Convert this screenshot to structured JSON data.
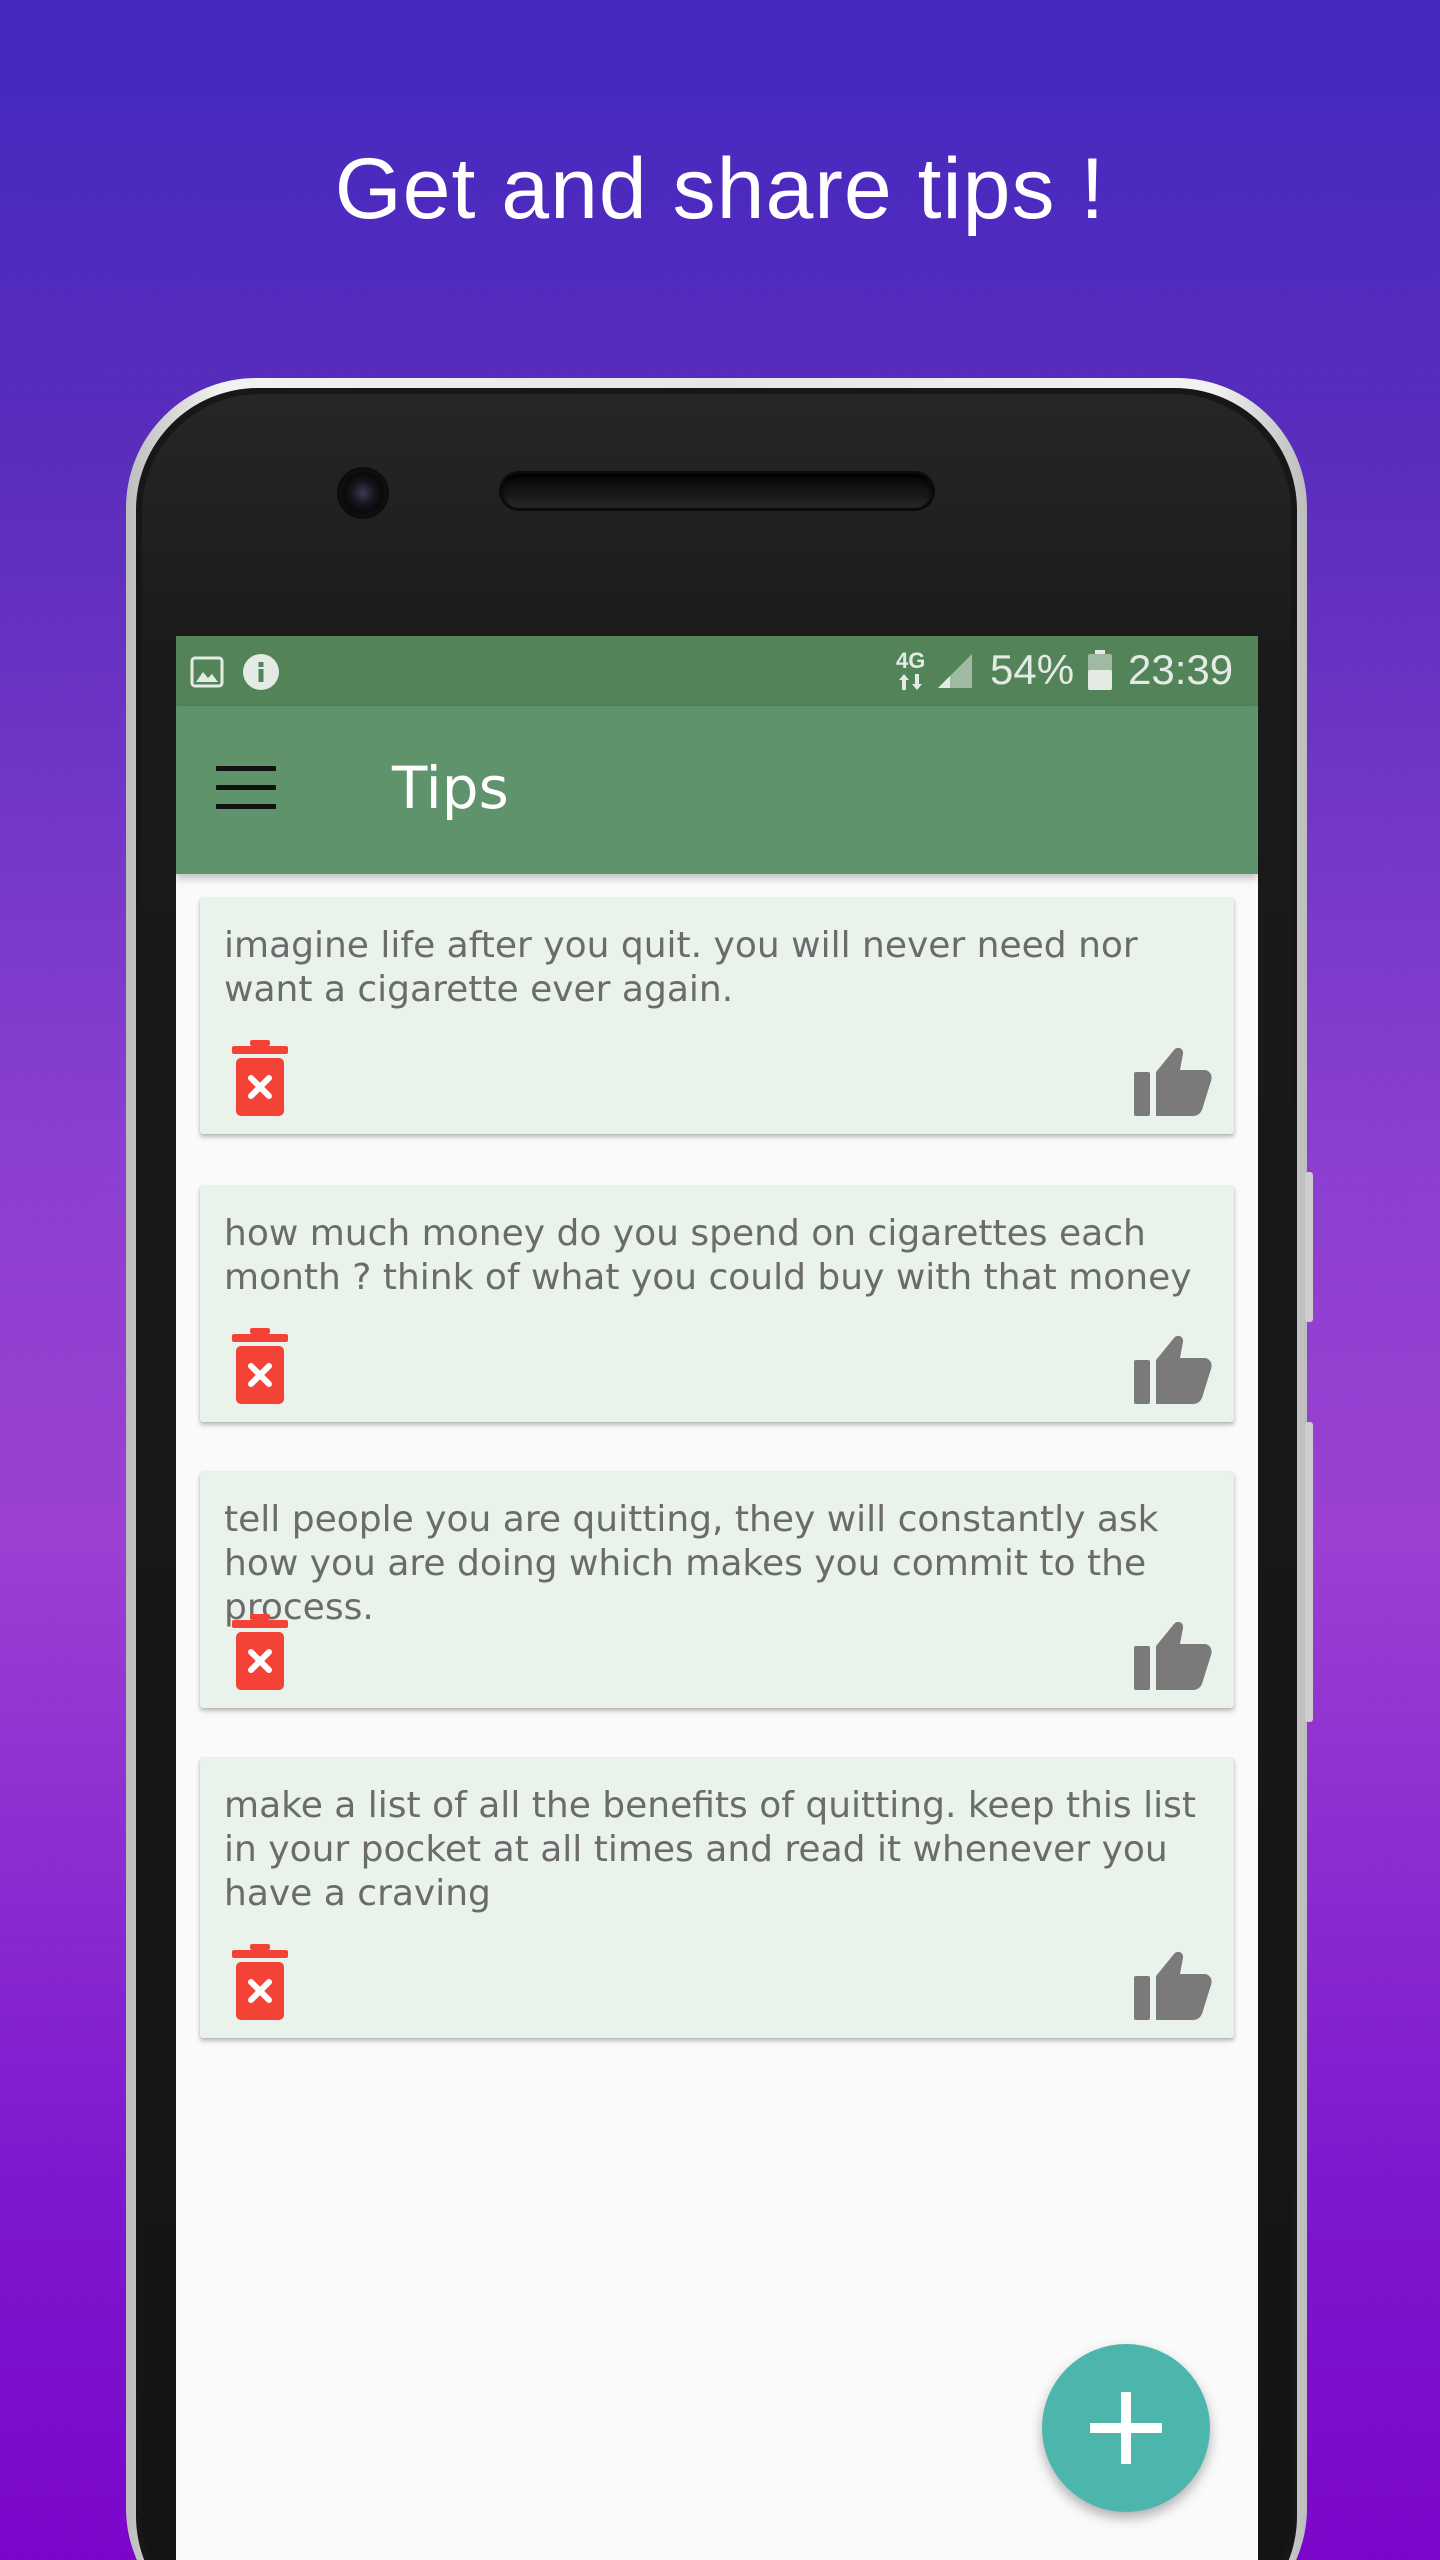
{
  "promo": {
    "headline": "Get and share tips !"
  },
  "status_bar": {
    "network": "4G",
    "battery": "54%",
    "time": "23:39",
    "icons": [
      "image-icon",
      "info-icon",
      "signal-icon",
      "battery-icon"
    ]
  },
  "app_bar": {
    "title": "Tips",
    "menu_icon": "menu-icon"
  },
  "tips": [
    {
      "text": "imagine life after you quit. you will never need nor want a cigarette ever again."
    },
    {
      "text": "how much money do you spend on cigarettes each month ? think of what you could buy with that money"
    },
    {
      "text": "tell people you are quitting, they will constantly ask how you are doing which makes you commit to the process."
    },
    {
      "text": "make a list of all the benefits of quitting. keep this list in your pocket at all times and read it whenever you have a craving"
    }
  ],
  "actions": {
    "delete_icon": "trash-icon",
    "like_icon": "thumbs-up-icon",
    "add_icon": "plus-icon"
  },
  "colors": {
    "status_bar": "#538459",
    "app_bar": "#5f936b",
    "card": "#eaf2ec",
    "delete": "#f44336",
    "like": "#7a7a7a",
    "fab": "#4db6ac"
  }
}
